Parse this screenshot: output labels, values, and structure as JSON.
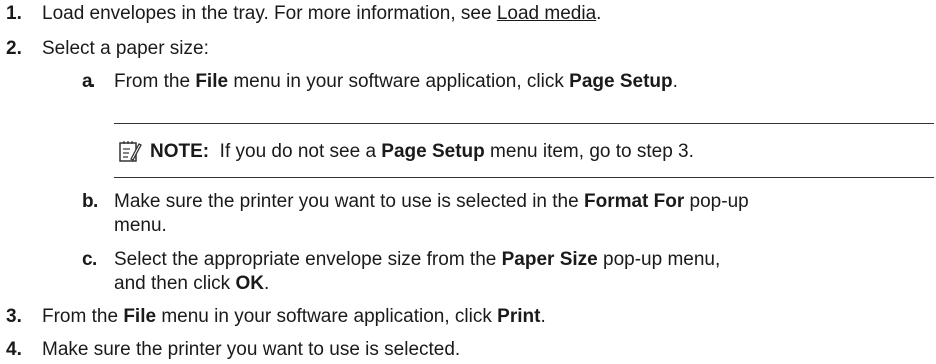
{
  "steps": {
    "s1": {
      "number": "1.",
      "text_before": "Load envelopes in the tray. For more information, see ",
      "link": "Load media",
      "text_after": "."
    },
    "s2": {
      "number": "2.",
      "text": "Select a paper size:",
      "a": {
        "letter": "a",
        "t1": "From the ",
        "b1": "File",
        "t2": " menu in your software application, click ",
        "b2": "Page Setup",
        "t3": "."
      },
      "note": {
        "icon": "note-pencil-icon",
        "label": "NOTE:",
        "t1": "If you do not see a ",
        "b1": "Page Setup",
        "t2": " menu item, go to step 3."
      },
      "b": {
        "letter": "b",
        "t1": "Make sure the printer you want to use is selected in the ",
        "b1": "Format For",
        "t2": " pop-up",
        "line2": "menu."
      },
      "c": {
        "letter": "c",
        "t1": "Select the appropriate envelope size from the ",
        "b1": "Paper Size",
        "t2": " pop-up menu,",
        "line2_t1": "and then click ",
        "line2_b1": "OK",
        "line2_t2": "."
      }
    },
    "s3": {
      "number": "3.",
      "t1": "From the ",
      "b1": "File",
      "t2": " menu in your software application, click ",
      "b2": "Print",
      "t3": "."
    },
    "s4": {
      "number": "4.",
      "text": "Make sure the printer you want to use is selected."
    }
  }
}
